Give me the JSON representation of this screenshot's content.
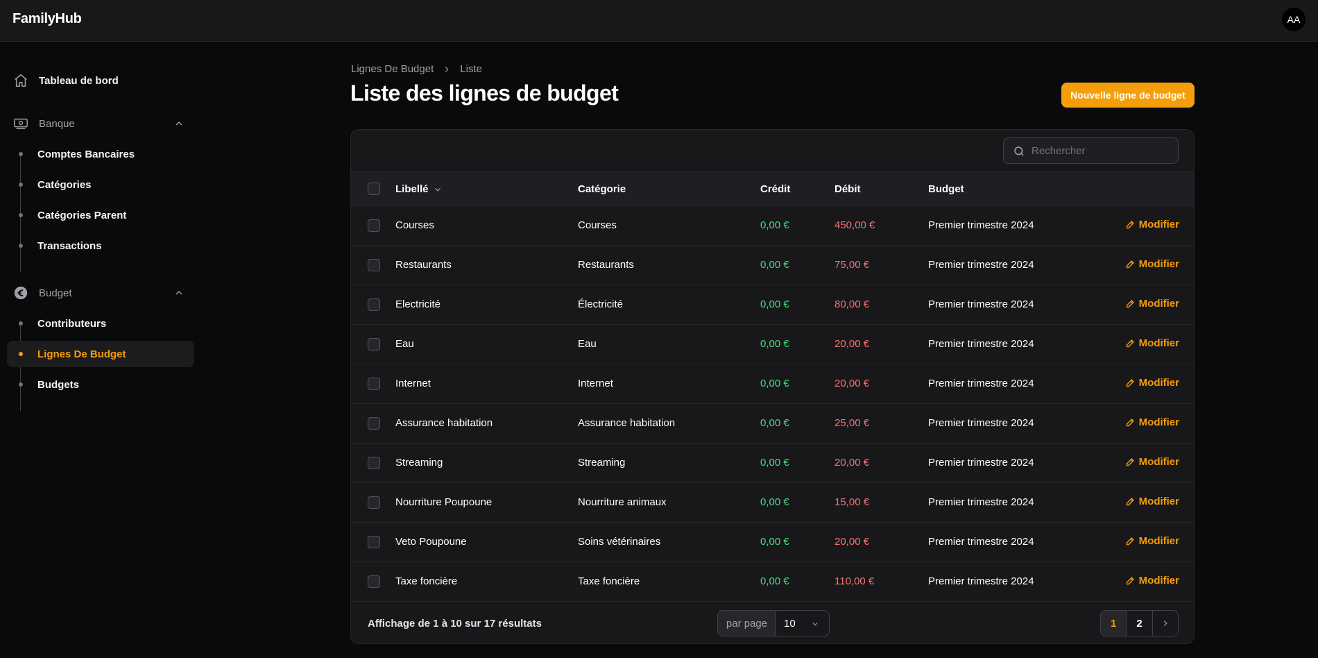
{
  "app": {
    "brand": "FamilyHub",
    "avatar": "AA"
  },
  "sidebar": {
    "dashboard": "Tableau de bord",
    "groups": [
      {
        "label": "Banque",
        "icon": "banknote-icon",
        "items": [
          "Comptes Bancaires",
          "Catégories",
          "Catégories Parent",
          "Transactions"
        ]
      },
      {
        "label": "Budget",
        "icon": "euro-icon",
        "items": [
          "Contributeurs",
          "Lignes De Budget",
          "Budgets"
        ]
      }
    ],
    "active_item": "Lignes De Budget"
  },
  "breadcrumb": {
    "parent": "Lignes De Budget",
    "current": "Liste"
  },
  "page": {
    "title": "Liste des lignes de budget",
    "new_button": "Nouvelle ligne de budget"
  },
  "search": {
    "placeholder": "Rechercher",
    "value": ""
  },
  "table": {
    "headers": {
      "label": "Libellé",
      "category": "Catégorie",
      "credit": "Crédit",
      "debit": "Débit",
      "budget": "Budget"
    },
    "action_label": "Modifier",
    "rows": [
      {
        "label": "Courses",
        "category": "Courses",
        "credit": "0,00 €",
        "debit": "450,00 €",
        "budget": "Premier trimestre 2024"
      },
      {
        "label": "Restaurants",
        "category": "Restaurants",
        "credit": "0,00 €",
        "debit": "75,00 €",
        "budget": "Premier trimestre 2024"
      },
      {
        "label": "Electricité",
        "category": "Électricité",
        "credit": "0,00 €",
        "debit": "80,00 €",
        "budget": "Premier trimestre 2024"
      },
      {
        "label": "Eau",
        "category": "Eau",
        "credit": "0,00 €",
        "debit": "20,00 €",
        "budget": "Premier trimestre 2024"
      },
      {
        "label": "Internet",
        "category": "Internet",
        "credit": "0,00 €",
        "debit": "20,00 €",
        "budget": "Premier trimestre 2024"
      },
      {
        "label": "Assurance habitation",
        "category": "Assurance habitation",
        "credit": "0,00 €",
        "debit": "25,00 €",
        "budget": "Premier trimestre 2024"
      },
      {
        "label": "Streaming",
        "category": "Streaming",
        "credit": "0,00 €",
        "debit": "20,00 €",
        "budget": "Premier trimestre 2024"
      },
      {
        "label": "Nourriture Poupoune",
        "category": "Nourriture animaux",
        "credit": "0,00 €",
        "debit": "15,00 €",
        "budget": "Premier trimestre 2024"
      },
      {
        "label": "Veto Poupoune",
        "category": "Soins vétérinaires",
        "credit": "0,00 €",
        "debit": "20,00 €",
        "budget": "Premier trimestre 2024"
      },
      {
        "label": "Taxe foncière",
        "category": "Taxe foncière",
        "credit": "0,00 €",
        "debit": "110,00 €",
        "budget": "Premier trimestre 2024"
      }
    ]
  },
  "footer": {
    "results": "Affichage de 1 à 10 sur 17 résultats",
    "per_page_label": "par page",
    "per_page_value": "10",
    "pages": [
      "1",
      "2"
    ],
    "current_page": "1"
  },
  "colors": {
    "accent": "#f59e0b",
    "credit": "#4ade80",
    "debit": "#f87171",
    "background": "#0a0a0b",
    "surface": "#18181b"
  }
}
